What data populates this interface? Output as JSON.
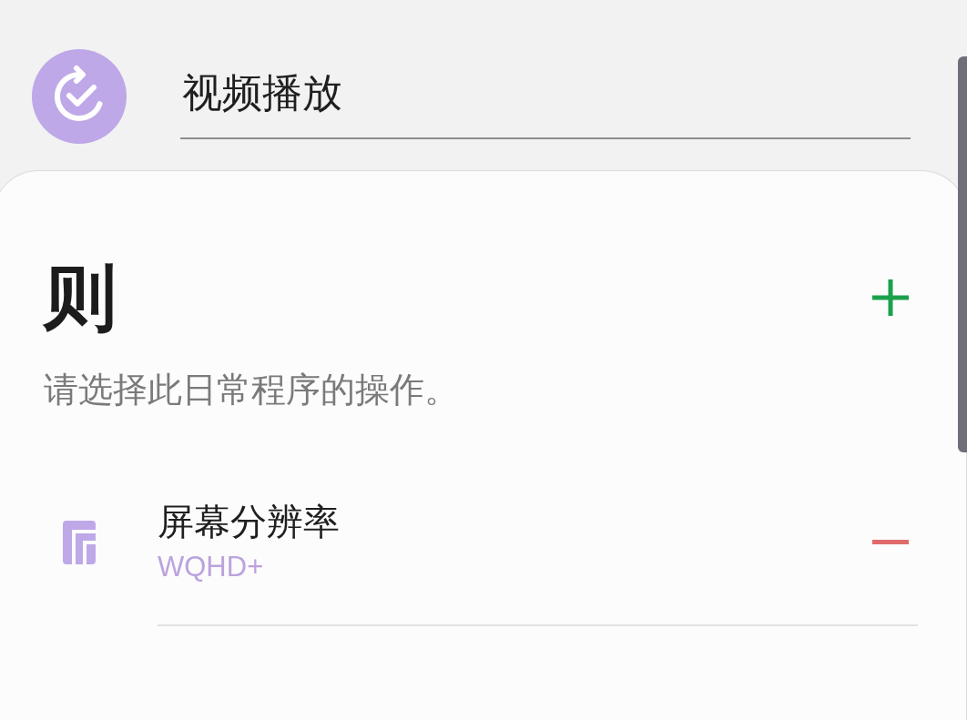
{
  "routine": {
    "name": "视频播放"
  },
  "then_section": {
    "heading": "则",
    "description": "请选择此日常程序的操作。"
  },
  "actions": [
    {
      "title": "屏幕分辨率",
      "value": "WQHD+"
    }
  ]
}
